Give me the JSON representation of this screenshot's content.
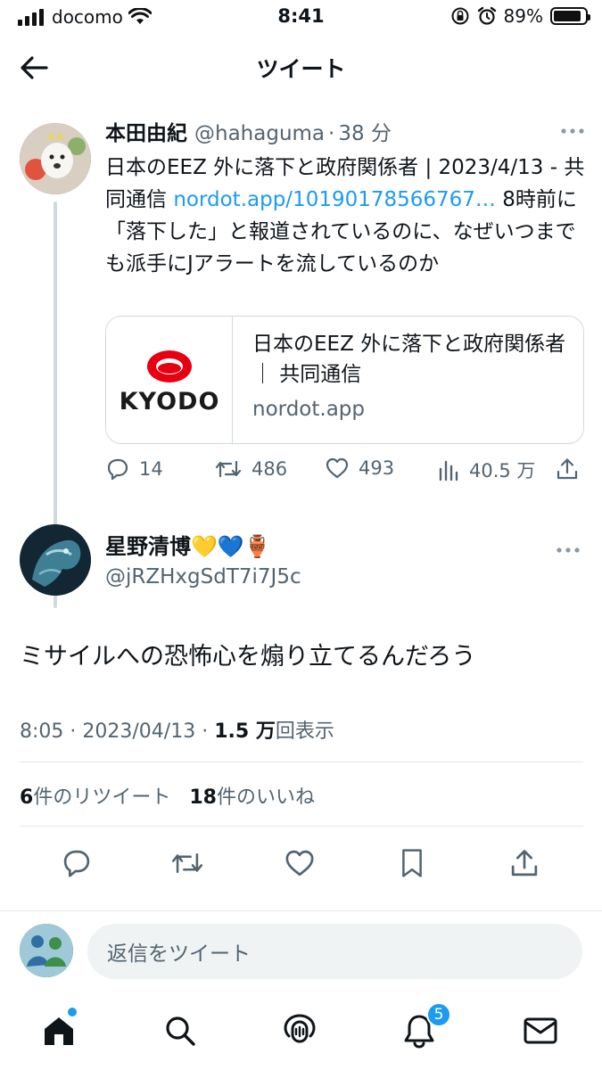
{
  "status_bar": {
    "carrier": "docomo",
    "time": "8:41",
    "battery_percent": "89%",
    "battery_level": 0.89
  },
  "header": {
    "title": "ツイート"
  },
  "parent_tweet": {
    "display_name": "本田由紀",
    "handle": "@hahaguma",
    "separator": "·",
    "age": "38 分",
    "text_before_link": "日本のEEZ 外に落下と政府関係者 | 2023/4/13 - 共同通信 ",
    "link": "nordot.app/10190178566767…",
    "text_after_link": " 8時前に「落下した」と報道されているのに、なぜいつまでも派手にJアラートを流しているのか",
    "card": {
      "logo_text": "KYODO",
      "title": "日本のEEZ 外に落下と政府関係者 ｜ 共同通信",
      "domain": "nordot.app"
    },
    "counts": {
      "replies": "14",
      "retweets": "486",
      "likes": "493",
      "views": "40.5 万"
    }
  },
  "main_tweet": {
    "display_name": "星野清博💛💙🏺",
    "handle": "@jRZHxgSdT7i7J5c",
    "text": "ミサイルへの恐怖心を煽り立てるんだろう",
    "time": "8:05",
    "date": "2023/04/13",
    "dot": "·",
    "view_count": "1.5 万",
    "view_label": "回表示",
    "retweet_count": "6",
    "retweet_label": "件のリツイート",
    "like_count": "18",
    "like_label": "件のいいね"
  },
  "reply_box": {
    "placeholder": "返信をツイート"
  },
  "tab_bar": {
    "notification_badge": "5"
  },
  "colors": {
    "accent": "#1d9bf0",
    "secondary_text": "#536471",
    "kyodo_red": "#e60012"
  }
}
